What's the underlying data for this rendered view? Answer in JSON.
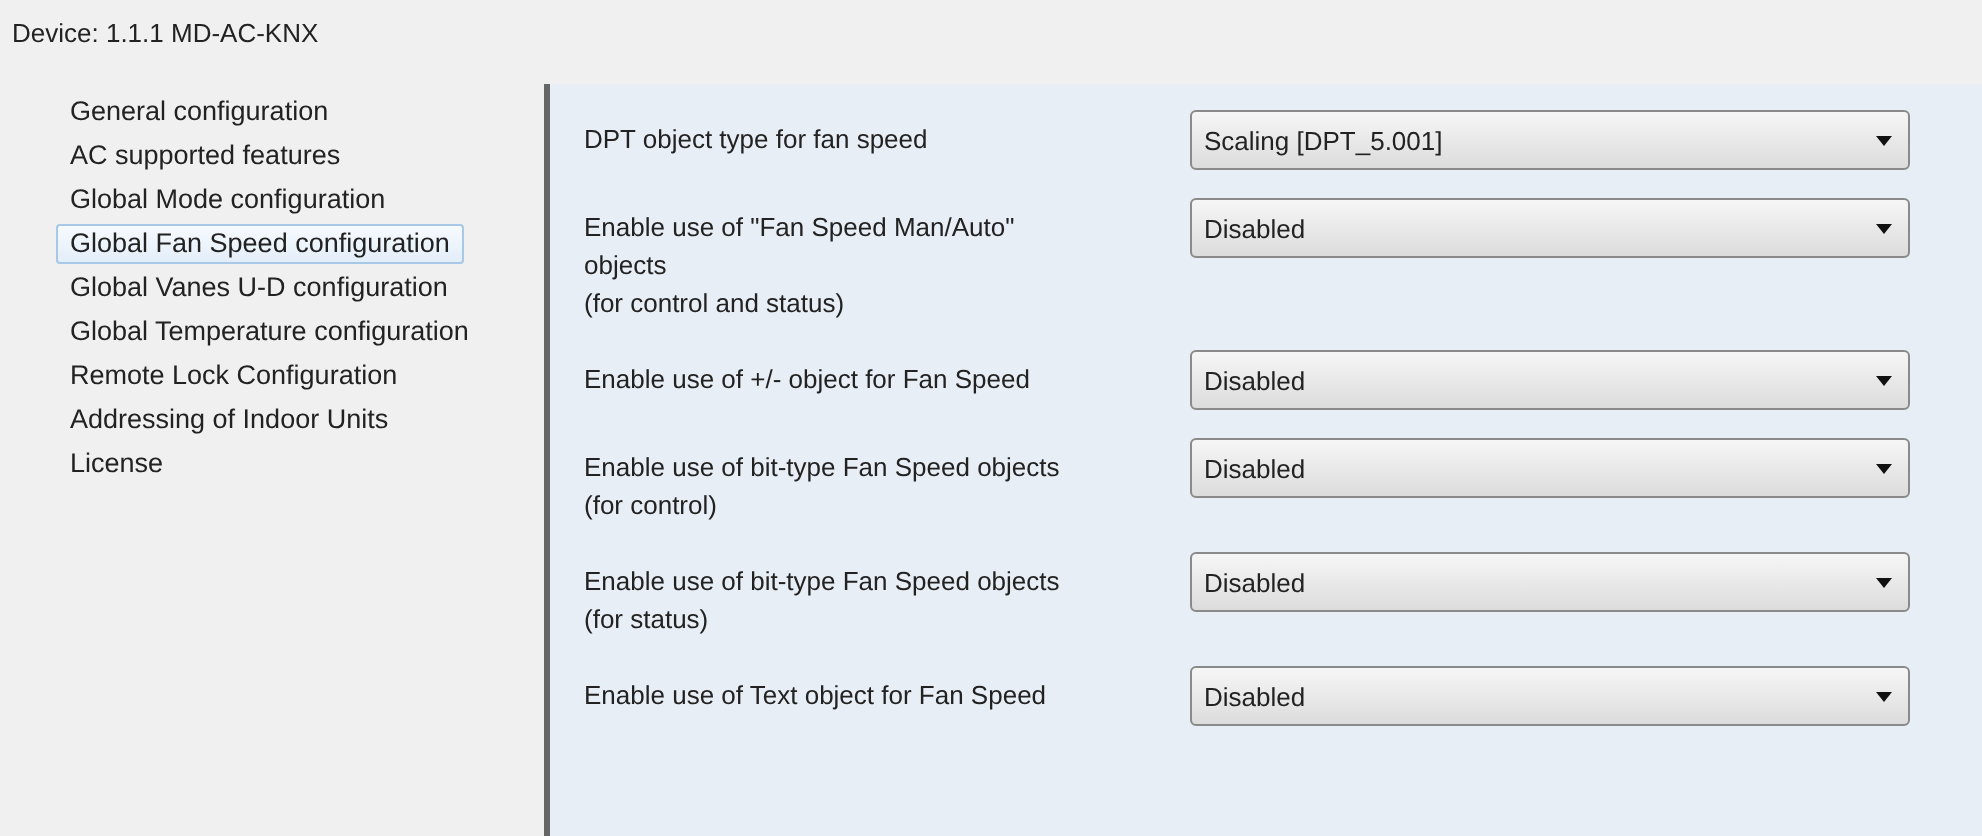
{
  "device_title": "Device: 1.1.1  MD-AC-KNX",
  "sidebar": {
    "items": [
      {
        "label": "General configuration",
        "selected": false
      },
      {
        "label": "AC supported features",
        "selected": false
      },
      {
        "label": "Global Mode configuration",
        "selected": false
      },
      {
        "label": "Global Fan Speed configuration",
        "selected": true
      },
      {
        "label": "Global Vanes U-D configuration",
        "selected": false
      },
      {
        "label": "Global Temperature configuration",
        "selected": false
      },
      {
        "label": "Remote Lock Configuration",
        "selected": false
      },
      {
        "label": "Addressing of Indoor Units",
        "selected": false
      },
      {
        "label": "License",
        "selected": false
      }
    ]
  },
  "parameters": [
    {
      "label": "DPT object type for fan speed",
      "value": "Scaling [DPT_5.001]"
    },
    {
      "label": "Enable use of \"Fan Speed Man/Auto\"\nobjects\n(for control and status)",
      "value": "Disabled"
    },
    {
      "label": "Enable use of +/- object for Fan Speed",
      "value": "Disabled"
    },
    {
      "label": "Enable use of bit-type Fan Speed objects\n(for control)",
      "value": "Disabled"
    },
    {
      "label": "Enable use of bit-type Fan Speed objects\n(for status)",
      "value": "Disabled"
    },
    {
      "label": "Enable use of Text object for Fan Speed",
      "value": "Disabled"
    }
  ]
}
